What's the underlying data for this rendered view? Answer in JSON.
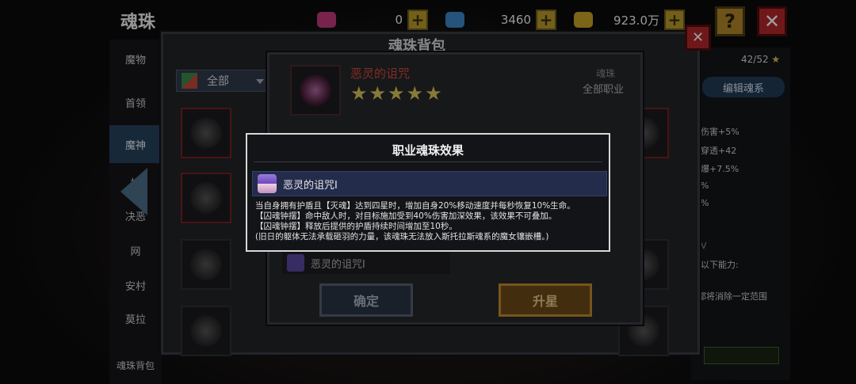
{
  "header": {
    "title": "魂珠",
    "currencies": [
      {
        "name": "gem",
        "value": "0",
        "color": "#c0397b"
      },
      {
        "name": "diamond",
        "value": "3460",
        "color": "#3a86c8"
      },
      {
        "name": "gold",
        "value": "923.0万",
        "color": "#c9a227"
      }
    ]
  },
  "left_nav": {
    "items": [
      "魔物",
      "首领",
      "魔神",
      "托",
      "决恶",
      "网",
      "安村",
      "莫拉"
    ],
    "active_index": 2,
    "bottom_label": "魂珠背包"
  },
  "bag": {
    "title": "魂珠背包",
    "filter_label": "全部"
  },
  "detail": {
    "name": "恶灵的诅咒",
    "stars": 5,
    "type_label": "魂珠",
    "job_label": "全部职业",
    "footer_name": "恶灵的诅咒Ⅰ",
    "confirm_label": "确定",
    "upgrade_label": "升星"
  },
  "right_panel": {
    "count": "42/52",
    "edit_label": "编辑魂系",
    "stats": [
      "伤害+5%",
      "穿透+42",
      "爆+7.5%",
      "%",
      "%",
      "V",
      "以下能力:",
      "都将消除一定范围"
    ]
  },
  "modal": {
    "title": "职业魂珠效果",
    "banner": "恶灵的诅咒Ⅰ",
    "desc_lines": [
      "当自身拥有护盾且【灭魂】达到四星时，增加自身20%移动速度并每秒恢复10%生命。",
      "【囚魂钟摆】命中敌人时，对目标施加受到40%伤害加深效果，该效果不可叠加。",
      "【囚魂钟摆】释放后提供的护盾持续时间增加至10秒。",
      "(旧日的躯体无法承载砸羽的力量，该魂珠无法放入斯托拉斯魂系的魔女镶嵌槽。)"
    ]
  }
}
